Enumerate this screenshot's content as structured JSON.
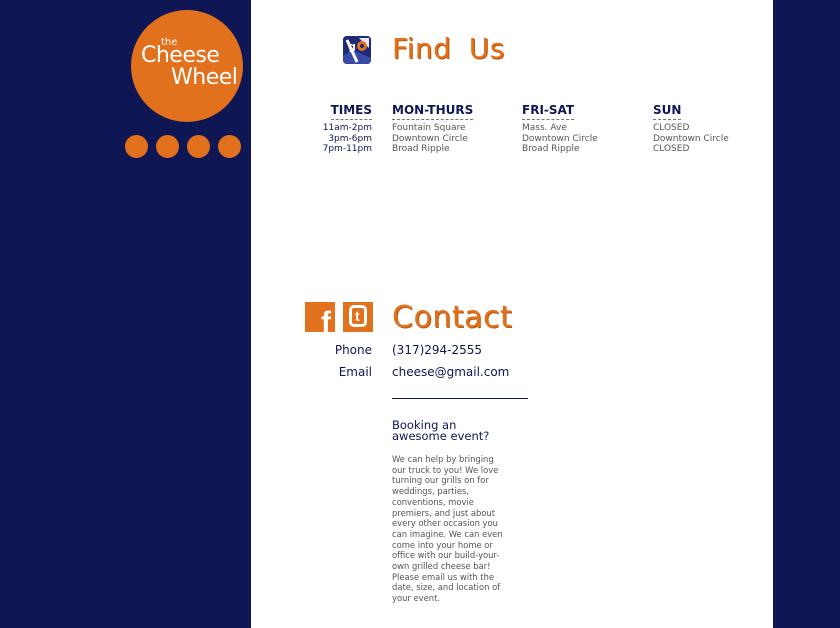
{
  "brand": {
    "logo_the": "the",
    "logo_cheese": "Cheese",
    "logo_wheel": "Wheel"
  },
  "nav": {
    "dots": [
      "nav-dot-1",
      "nav-dot-2",
      "nav-dot-3",
      "nav-dot-4"
    ]
  },
  "colors": {
    "navy": "#0f1654",
    "orange": "#e2711d",
    "panel": "#ffffff"
  },
  "find_us": {
    "title": "Find Us",
    "icon": "google-maps-icon",
    "times": {
      "header": "TIMES",
      "rows": [
        "11am-2pm",
        "3pm-6pm",
        "7pm-11pm"
      ]
    },
    "mon_thurs": {
      "header": "MON-THURS",
      "rows": [
        "Fountain Square",
        "Downtown Circle",
        "Broad Ripple"
      ]
    },
    "fri_sat": {
      "header": "FRI-SAT",
      "rows": [
        "Mass. Ave",
        "Downtown Circle",
        "Broad Ripple"
      ]
    },
    "sun": {
      "header": "SUN",
      "rows": [
        "CLOSED",
        "Downtown Circle",
        "CLOSED"
      ]
    }
  },
  "contact": {
    "title": "Contact",
    "icons": [
      "facebook-icon",
      "twitter-icon"
    ],
    "phone_label": "Phone",
    "phone_value": "(317)294-2555",
    "email_label": "Email",
    "email_value": "cheese@gmail.com",
    "booking_heading": "Booking an awesome event?",
    "booking_text": "We can help by bringing our truck to you! We love turning our grills on for weddings, parties, conventions, movie premiers, and just about every other occasion you can imagine. We can even come into your home or office with our build-your-own grilled cheese bar! Please email us with the date, size, and location of your event."
  }
}
